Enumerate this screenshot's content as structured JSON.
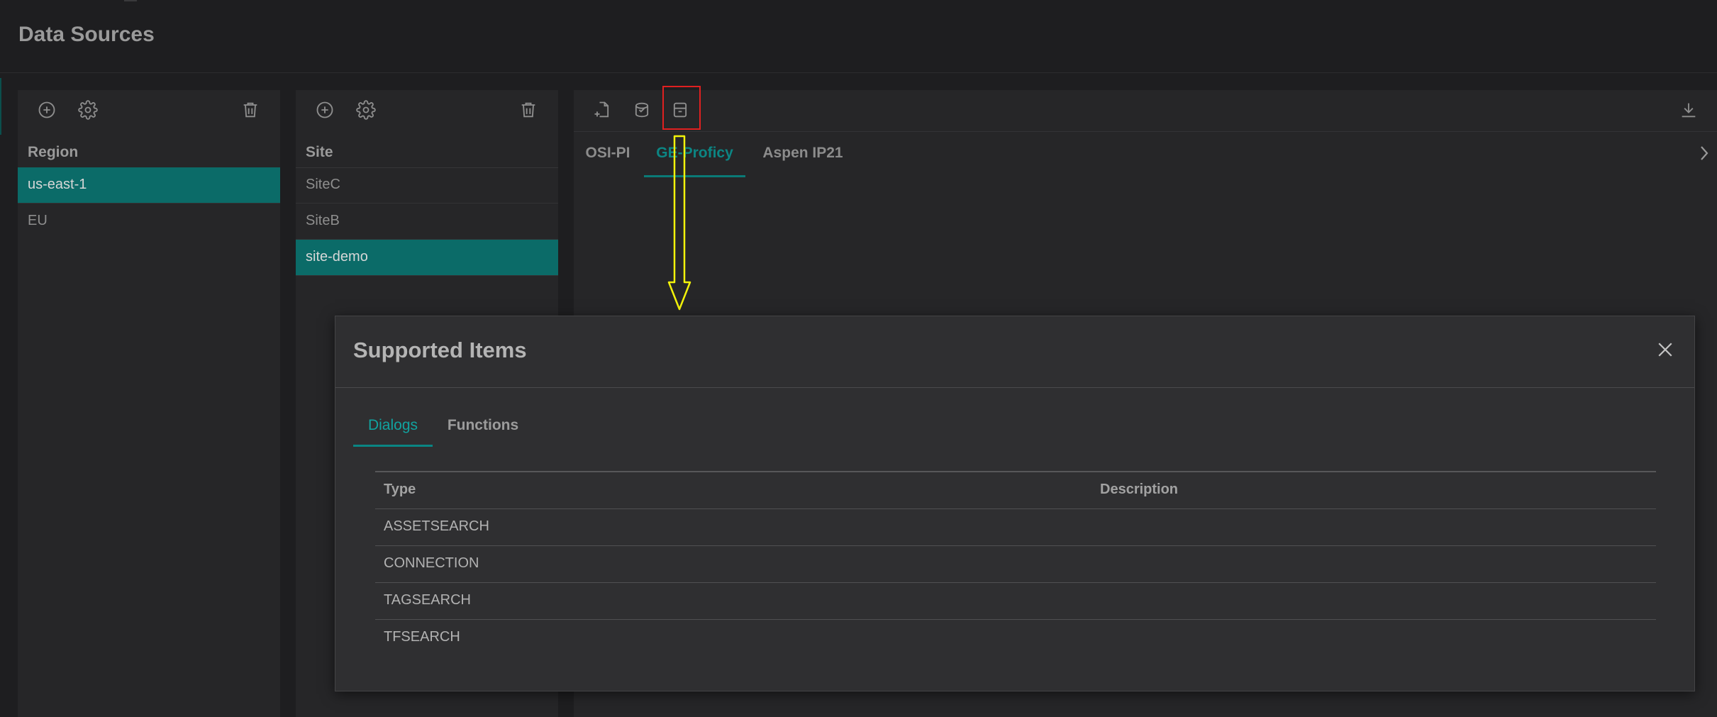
{
  "page": {
    "title": "Data Sources"
  },
  "region_panel": {
    "header": "Region",
    "items": [
      {
        "label": "us-east-1",
        "selected": true
      },
      {
        "label": "EU",
        "selected": false
      }
    ]
  },
  "site_panel": {
    "header": "Site",
    "items": [
      {
        "label": "SiteC",
        "selected": false
      },
      {
        "label": "SiteB",
        "selected": false
      },
      {
        "label": "site-demo",
        "selected": true
      }
    ]
  },
  "main_panel": {
    "tabs": [
      {
        "label": "OSI-PI",
        "active": false
      },
      {
        "label": "GE-Proficy",
        "active": true
      },
      {
        "label": "Aspen IP21",
        "active": false
      }
    ]
  },
  "modal": {
    "title": "Supported Items",
    "tabs": [
      {
        "label": "Dialogs",
        "active": true
      },
      {
        "label": "Functions",
        "active": false
      }
    ],
    "columns": [
      "Type",
      "Description"
    ],
    "rows": [
      {
        "type": "ASSETSEARCH",
        "description": ""
      },
      {
        "type": "CONNECTION",
        "description": ""
      },
      {
        "type": "TAGSEARCH",
        "description": ""
      },
      {
        "type": "TFSEARCH",
        "description": ""
      }
    ]
  },
  "colors": {
    "accent": "#0b6b68",
    "accent_text": "#11a3a0",
    "highlight_box": "#e02020",
    "annotation_arrow": "#f2f20a",
    "background": "#1c1c1e",
    "panel": "#262628",
    "modal": "#2f2f31"
  },
  "icons": [
    "plus-circle-icon",
    "gear-icon",
    "trash-icon",
    "new-file-icon",
    "database-icon",
    "archive-box-icon",
    "download-icon",
    "chevron-right-icon",
    "close-icon"
  ]
}
